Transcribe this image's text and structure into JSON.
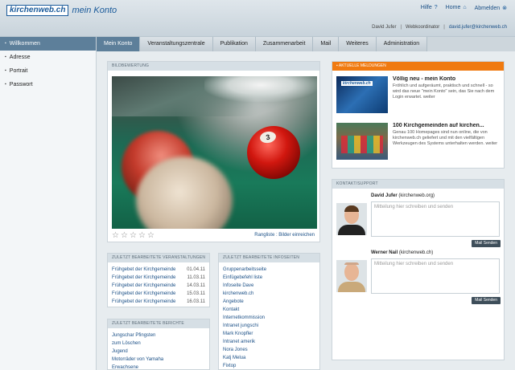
{
  "header": {
    "logo_text": "kirchenweb.ch",
    "logo_sub": "mein Konto",
    "links": [
      {
        "label": "Hilfe",
        "sym": "?"
      },
      {
        "label": "Home",
        "sym": "⌂"
      },
      {
        "label": "Abmelden",
        "sym": "⊗"
      }
    ],
    "user_name": "David Jufer",
    "user_role": "Webkoordinator",
    "user_email": "david.jufer@kirchenweb.ch"
  },
  "sidebar": {
    "items": [
      {
        "label": "Willkommen",
        "active": true
      },
      {
        "label": "Adresse",
        "active": false
      },
      {
        "label": "Portrait",
        "active": false
      },
      {
        "label": "Passwort",
        "active": false
      }
    ]
  },
  "tabs": [
    {
      "label": "Mein Konto",
      "active": true
    },
    {
      "label": "Veranstaltungszentrale",
      "active": false
    },
    {
      "label": "Publikation",
      "active": false
    },
    {
      "label": "Zusammenarbeit",
      "active": false
    },
    {
      "label": "Mail",
      "active": false
    },
    {
      "label": "Weiteres",
      "active": false
    },
    {
      "label": "Administration",
      "active": false
    }
  ],
  "image_panel": {
    "heading": "BILDBEWERTUNG",
    "ball_number": "3",
    "rating_max": 5,
    "rating_link": "Rangliste : Bilder einreichen"
  },
  "events_panel": {
    "heading": "ZULETZT BEARBEITETE VERANSTALTUNGEN",
    "rows": [
      {
        "title": "Frühgebet der Kirchgemeinde",
        "date": "01.04.11"
      },
      {
        "title": "Frühgebet der Kirchgemeinde",
        "date": "11.03.11"
      },
      {
        "title": "Frühgebet der Kirchgemeinde",
        "date": "14.03.11"
      },
      {
        "title": "Frühgebet der Kirchgemeinde",
        "date": "15.03.11"
      },
      {
        "title": "Frühgebet der Kirchgemeinde",
        "date": "16.03.11"
      }
    ]
  },
  "reports_panel": {
    "heading": "ZULETZT BEARBEITETE BERICHTE",
    "rows": [
      "Jungschar Pfingsten",
      "zum Löschen",
      "Jugend",
      "Motorräder von Yamaha",
      "Erwachsene"
    ]
  },
  "infos_panel": {
    "heading": "ZULETZT BEARBEITETE INFOSEITEN",
    "rows": [
      "Gruppenarbeitsseite",
      "Einfügebefehl liste",
      "Infoseite Dave",
      "kirchenweb.ch",
      "Angebote",
      "Kontakt",
      "Internetkommission",
      "Intranet jungschi",
      "Mark Knopfler",
      "Intranet amerik",
      "Nora Jones",
      "Katj Melua",
      "Fixtop"
    ]
  },
  "news_panel": {
    "heading": "AKTUELLE MELDUNGEN",
    "items": [
      {
        "title": "Völlig neu - mein Konto",
        "body": "Fröhlich und aufgeräumt, praktisch und schnell - so wird das neue \"mein Konto\" sein, das Sie nach dem Login erwartet. weiter",
        "thumb_logo": "kirchenweb.ch"
      },
      {
        "title": "100 Kirchgemeinden auf kirchen...",
        "body": "Genau 100 Homepages sind nun online, die von kirchenweb.ch geliefert und mit den vielfältigen Werkzeugen des Systems unterhalten werden. weiter"
      }
    ]
  },
  "contact_panel": {
    "heading": "KONTAKT/SUPPORT",
    "contacts": [
      {
        "name": "David Jufer",
        "org": "(kirchenweb.org)",
        "placeholder": "Mitteilung hier schreiben und senden",
        "button": "Mail Senden"
      },
      {
        "name": "Werner Nail",
        "org": "(kirchenweb.ch)",
        "placeholder": "Mitteilung hier schreiben und senden",
        "button": "Mail Senden"
      }
    ]
  },
  "colors": {
    "accent": "#5d7f9a",
    "news_header": "#f07a10",
    "link": "#1a4f86"
  }
}
